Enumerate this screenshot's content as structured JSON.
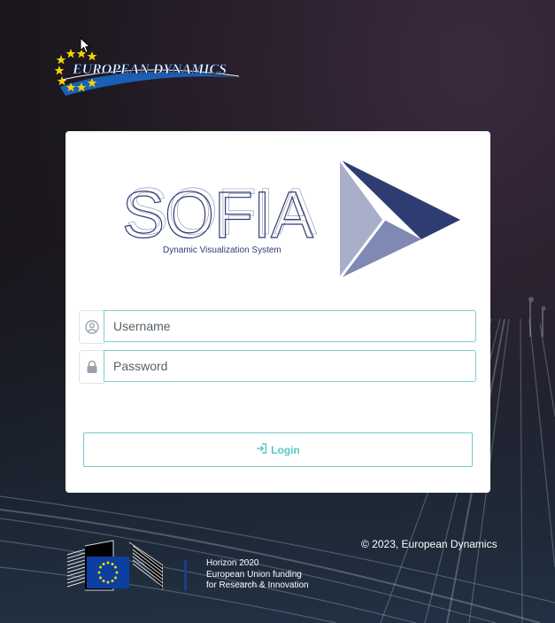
{
  "brand": {
    "logo_text": "EUROPEAN DYNAMICS"
  },
  "app": {
    "name": "SOFIA",
    "tagline": "Dynamic Visualization System"
  },
  "form": {
    "username": {
      "placeholder": "Username",
      "value": "",
      "icon": "user-circle-icon"
    },
    "password": {
      "placeholder": "Password",
      "value": "",
      "icon": "lock-icon"
    },
    "login_label": "Login",
    "login_icon": "sign-in-icon"
  },
  "footer": {
    "copyright": "© 2023, European Dynamics",
    "horizon": {
      "line1": "Horizon 2020",
      "line2": "European Union funding",
      "line3": "for Research & Innovation"
    }
  },
  "colors": {
    "accent": "#5bc6c6",
    "logo_navy": "#2e3c72",
    "logo_light": "#a9aec9",
    "logo_mid": "#7f89b3"
  }
}
